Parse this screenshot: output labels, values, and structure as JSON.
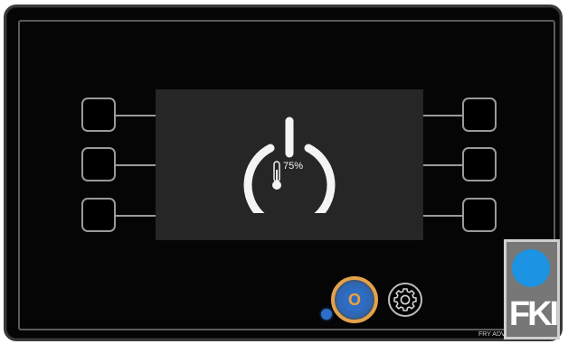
{
  "display": {
    "temperature_percent": "75%",
    "power_icon": "power-icon",
    "thermometer_icon": "thermometer-icon"
  },
  "side_buttons": {
    "left": [
      "",
      "",
      ""
    ],
    "right": [
      "",
      "",
      ""
    ]
  },
  "controls": {
    "o_button_label": "O",
    "settings_icon": "gear-icon",
    "indicator": "status-led"
  },
  "branding": {
    "logo_text": "FKI",
    "model_label": "FRY ADV"
  },
  "colors": {
    "bezel": "#050505",
    "screen": "#262626",
    "accent_orange": "#e3a24a",
    "button_blue": "#2f6dc4",
    "logo_blue": "#1d93e3",
    "logo_bg": "#777777"
  }
}
